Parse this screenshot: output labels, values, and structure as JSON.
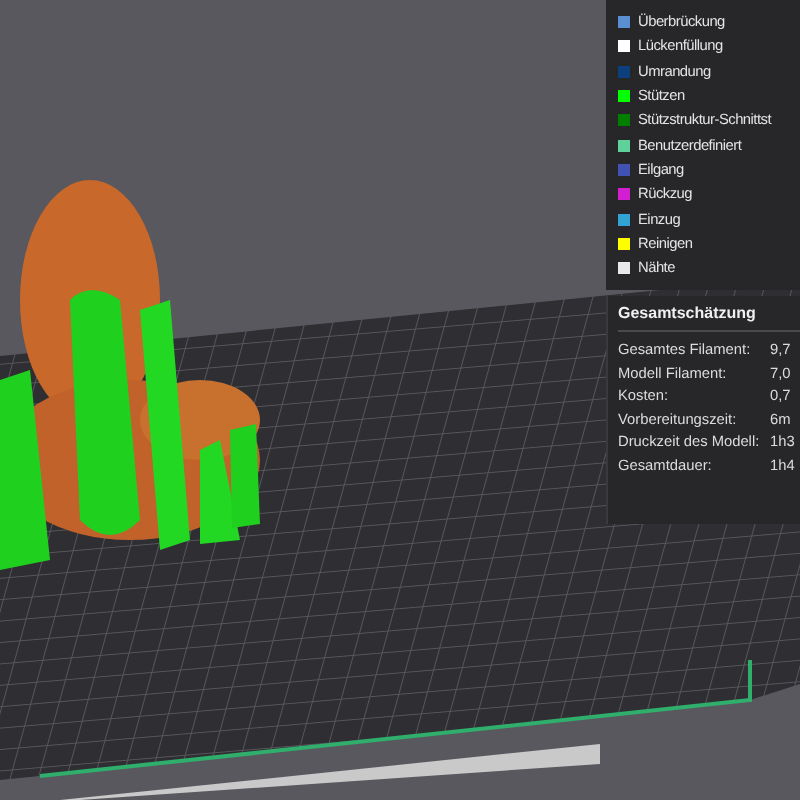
{
  "legend": {
    "items": [
      {
        "label": "Überbrückung",
        "color": "#5b8fd4"
      },
      {
        "label": "Lückenfüllung",
        "color": "#ffffff"
      },
      {
        "label": "Umrandung",
        "color": "#0c3f7c"
      },
      {
        "label": "Stützen",
        "color": "#00ff00"
      },
      {
        "label": "Stützstruktur-Schnittst",
        "color": "#008000"
      },
      {
        "label": "Benutzerdefiniert",
        "color": "#5fd19b"
      },
      {
        "label": "Eilgang",
        "color": "#4252b2"
      },
      {
        "label": "Rückzug",
        "color": "#d11fd1"
      },
      {
        "label": "Einzug",
        "color": "#33a3d4"
      },
      {
        "label": "Reinigen",
        "color": "#ffff00"
      },
      {
        "label": "Nähte",
        "color": "#e8e8e8"
      }
    ]
  },
  "estimate": {
    "title": "Gesamtschätzung",
    "rows": [
      {
        "label": "Gesamtes Filament:",
        "value": "9,7"
      },
      {
        "label": "Modell Filament:",
        "value": "7,0"
      },
      {
        "label": "Kosten:",
        "value": "0,7"
      },
      {
        "label": "Vorbereitungszeit:",
        "value": "6m"
      },
      {
        "label": "Druckzeit des Modell:",
        "value": "1h3"
      },
      {
        "label": "Gesamtdauer:",
        "value": "1h4"
      }
    ]
  }
}
